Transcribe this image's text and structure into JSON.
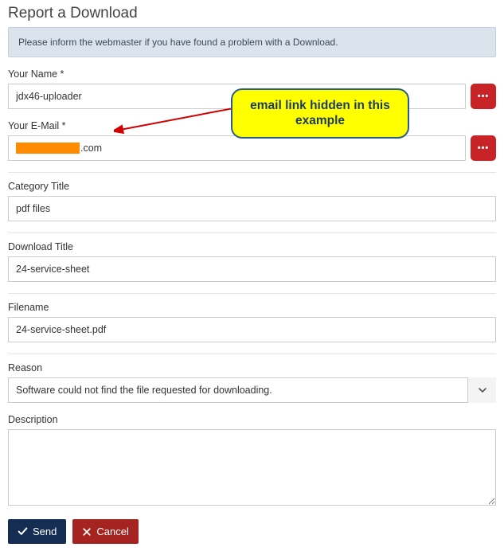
{
  "page": {
    "title": "Report a Download",
    "info": "Please inform the webmaster if you have found a problem with a Download."
  },
  "fields": {
    "name": {
      "label": "Your Name *",
      "value": "jdx46-uploader"
    },
    "email": {
      "label": "Your E-Mail *",
      "suffix": ".com"
    },
    "category": {
      "label": "Category Title",
      "value": "pdf files"
    },
    "download": {
      "label": "Download Title",
      "value": "24-service-sheet"
    },
    "filename": {
      "label": "Filename",
      "value": "24-service-sheet.pdf"
    },
    "reason": {
      "label": "Reason",
      "value": "Software could not find the file requested for downloading."
    },
    "description": {
      "label": "Description",
      "value": ""
    }
  },
  "buttons": {
    "send": "Send",
    "cancel": "Cancel"
  },
  "annotation": {
    "callout": "email link hidden in this example"
  }
}
